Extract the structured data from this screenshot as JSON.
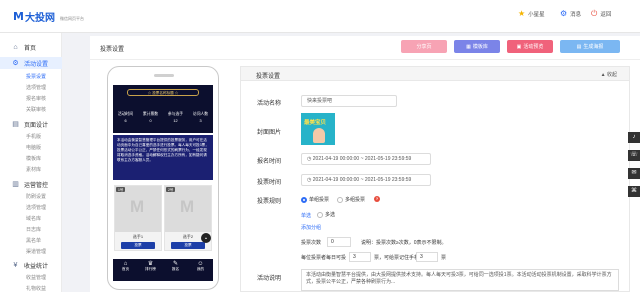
{
  "header": {
    "logo_mark": "M",
    "logo_name": "大投网",
    "logo_sub": "微信网页平台",
    "user": "小星星",
    "messages": "消息",
    "back": "返回"
  },
  "sidebar": {
    "groups": [
      {
        "label": "首页",
        "icon": "home-icon",
        "items": []
      },
      {
        "label": "活动设置",
        "icon": "gear-icon",
        "items": [
          "投票设置",
          "选项管理",
          "报名审核",
          "关联审核"
        ]
      },
      {
        "label": "页面设计",
        "icon": "page-icon",
        "items": [
          "手机版",
          "电脑版",
          "模板库",
          "素材库"
        ]
      },
      {
        "label": "运营管控",
        "icon": "chart-icon",
        "items": [
          "防刷设置",
          "选项管理",
          "域名库",
          "日志库",
          "黑名单",
          "渠道管理"
        ]
      },
      {
        "label": "收益统计",
        "icon": "money-icon",
        "items": [
          "收益管理",
          "礼物收益"
        ]
      }
    ]
  },
  "page": {
    "title": "投票设置",
    "buttons": [
      "分享页",
      "模板库",
      "活动预览",
      "生成海报"
    ]
  },
  "phone": {
    "banner_title": "☆ 投票名称标题 ☆",
    "stats": [
      {
        "label": "活动时间",
        "value": "6"
      },
      {
        "label": "累计票数",
        "value": "0"
      },
      {
        "label": "参与选手",
        "value": "12"
      },
      {
        "label": "访问人数",
        "value": "3"
      }
    ],
    "description": "本活动由衡量智慧管理平台提供的投票服务，用户可在活动页面中为自己喜爱的选手进行投票。每人每天可投3票，投票活动公平公正，严禁任何形式的刷票行为，一经发现将取消选手资格。活动解释权归主办方所有，如有疑问请联系主办方客服人员。",
    "cards": [
      {
        "num": "1号",
        "name": "选手1",
        "vote": "投票"
      },
      {
        "num": "2号",
        "name": "选手2",
        "vote": "投票"
      }
    ],
    "tabs": [
      {
        "label": "首页",
        "icon": "⌂"
      },
      {
        "label": "排行榜",
        "icon": "♛"
      },
      {
        "label": "报名",
        "icon": "✎"
      },
      {
        "label": "我的",
        "icon": "☺"
      }
    ]
  },
  "form": {
    "panel_title": "投票设置",
    "collapse": "收起",
    "name_label": "活动名称",
    "name_value": "快来投票吧",
    "cover_label": "封面图片",
    "cover_text": "最美宝贝",
    "signup_label": "报名时间",
    "signup_value": "2021-04-19 00:00:00  ~  2021-05-19 23:59:59",
    "vote_label": "投票时间",
    "vote_value": "2021-04-19 00:00:00  ~  2021-05-19 23:59:59",
    "rule_label": "投票规则",
    "rule_single": "单组投票",
    "rule_multi": "多组投票",
    "choose_single": "单选",
    "choose_multi": "多选",
    "link1": "添加分组",
    "vote_count_label": "投票次数",
    "vote_count": "0",
    "vote_count_note": "说明：投票次数≥次数，0表示不限制。",
    "daily_label": "每位投票者每日可投",
    "daily_value": "3",
    "daily_unit": "票，可给票记住手机",
    "daily_value2": "3",
    "daily_unit2": "票",
    "intro_label": "活动说明",
    "intro_text": "本活动由衡量智慧平台提供，由大投网提供技术支持。每人每天可投3票，可给同一选项投1票。本活动活动投票机制设置，采取科学计票方式，投票公平公正，严禁各种刷票行为..."
  },
  "float_bar": [
    "bell-icon",
    "phone-icon",
    "chat-icon",
    "cart-icon"
  ]
}
